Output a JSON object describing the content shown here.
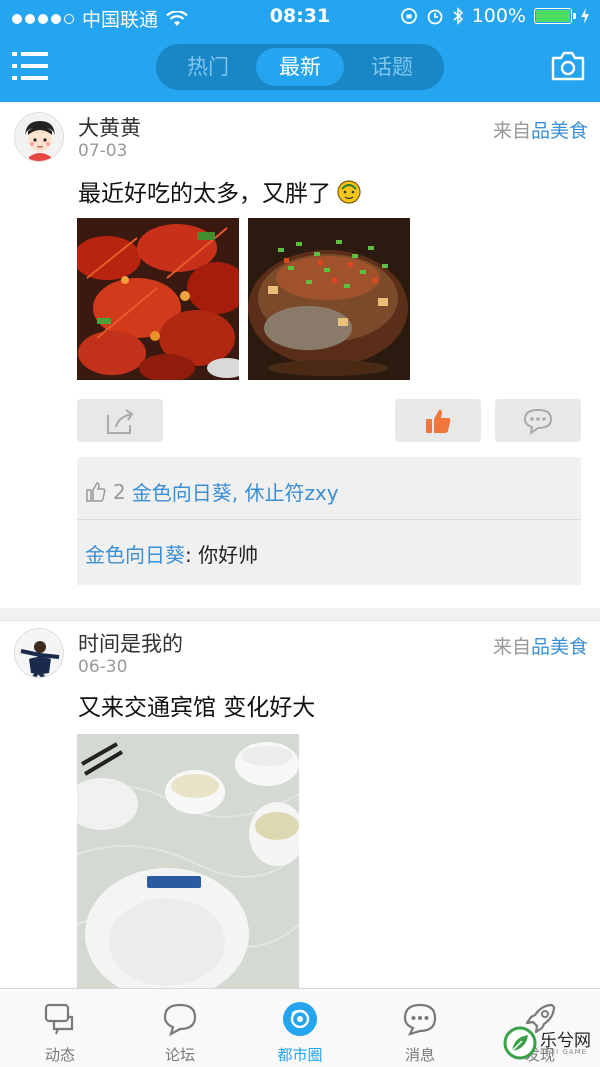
{
  "status_bar": {
    "carrier": "中国联通",
    "time": "08:31",
    "battery": "100%"
  },
  "header": {
    "tabs": [
      {
        "label": "热门",
        "active": false
      },
      {
        "label": "最新",
        "active": true
      },
      {
        "label": "话题",
        "active": false
      }
    ]
  },
  "posts": [
    {
      "user": "大黄黄",
      "date": "07-03",
      "source_prefix": "来自",
      "source_category": "品美食",
      "text": "最近好吃的太多，又胖了",
      "like_count": "2",
      "liked_by": "金色向日葵, 休止符zxy",
      "comment_author": "金色向日葵",
      "comment_sep": ":",
      "comment_text": "你好帅"
    },
    {
      "user": "时间是我的",
      "date": "06-30",
      "source_prefix": "来自",
      "source_category": "品美食",
      "text": "又来交通宾馆 变化好大"
    }
  ],
  "tab_bar": [
    {
      "label": "动态",
      "active": false
    },
    {
      "label": "论坛",
      "active": false
    },
    {
      "label": "都市圈",
      "active": true
    },
    {
      "label": "消息",
      "active": false
    },
    {
      "label": "发现",
      "active": false
    }
  ],
  "watermark": {
    "text": "乐兮网",
    "sub": "LEXI GAME"
  },
  "colors": {
    "brand": "#25a4ef",
    "link": "#3b8fd6",
    "like": "#f0763c"
  }
}
